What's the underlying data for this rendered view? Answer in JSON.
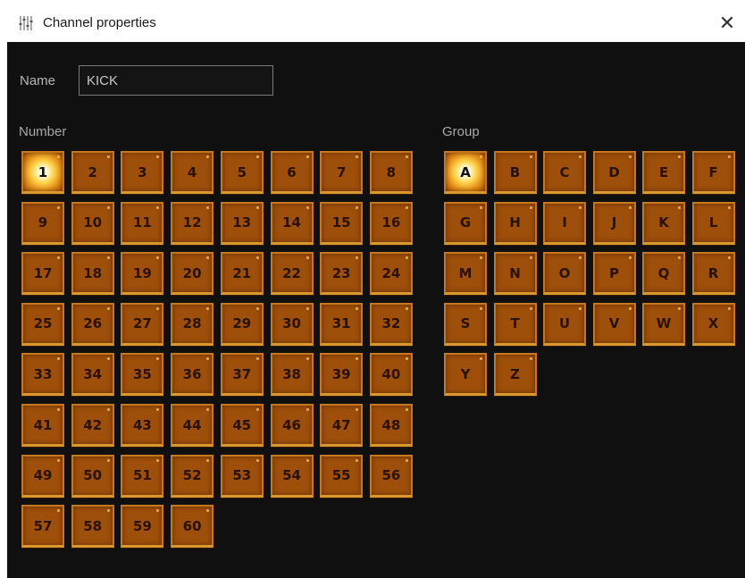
{
  "window": {
    "title": "Channel properties",
    "close_glyph": "✕"
  },
  "name_field": {
    "label": "Name",
    "value": "KICK"
  },
  "number_section": {
    "label": "Number",
    "selected": "1",
    "items": [
      "1",
      "2",
      "3",
      "4",
      "5",
      "6",
      "7",
      "8",
      "9",
      "10",
      "11",
      "12",
      "13",
      "14",
      "15",
      "16",
      "17",
      "18",
      "19",
      "20",
      "21",
      "22",
      "23",
      "24",
      "25",
      "26",
      "27",
      "28",
      "29",
      "30",
      "31",
      "32",
      "33",
      "34",
      "35",
      "36",
      "37",
      "38",
      "39",
      "40",
      "41",
      "42",
      "43",
      "44",
      "45",
      "46",
      "47",
      "48",
      "49",
      "50",
      "51",
      "52",
      "53",
      "54",
      "55",
      "56",
      "57",
      "58",
      "59",
      "60"
    ]
  },
  "group_section": {
    "label": "Group",
    "selected": "A",
    "items": [
      "A",
      "B",
      "C",
      "D",
      "E",
      "F",
      "G",
      "H",
      "I",
      "J",
      "K",
      "L",
      "M",
      "N",
      "O",
      "P",
      "Q",
      "R",
      "S",
      "T",
      "U",
      "V",
      "W",
      "X",
      "Y",
      "Z"
    ]
  }
}
